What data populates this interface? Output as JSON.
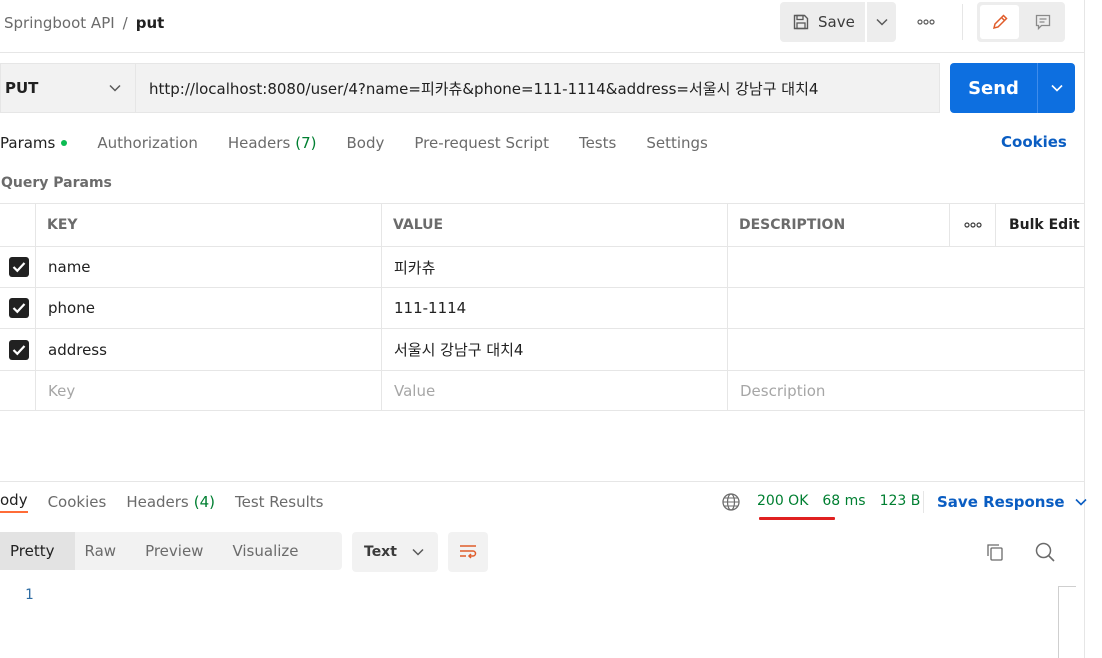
{
  "header": {
    "breadcrumb_parent": "Springboot API",
    "breadcrumb_sep": "/",
    "breadcrumb_current": "put",
    "save_label": "Save"
  },
  "request": {
    "method": "PUT",
    "url": "http://localhost:8080/user/4?name=피카츄&phone=111-1114&address=서울시 강남구 대치4",
    "send_label": "Send"
  },
  "tabs": [
    {
      "label": "Params",
      "count": ""
    },
    {
      "label": "Authorization",
      "count": ""
    },
    {
      "label": "Headers",
      "count": "(7)"
    },
    {
      "label": "Body",
      "count": ""
    },
    {
      "label": "Pre-request Script",
      "count": ""
    },
    {
      "label": "Tests",
      "count": ""
    },
    {
      "label": "Settings",
      "count": ""
    }
  ],
  "cookies_label": "Cookies",
  "query_params": {
    "title": "Query Params",
    "columns": {
      "key": "KEY",
      "value": "VALUE",
      "description": "DESCRIPTION",
      "bulk_edit": "Bulk Edit"
    },
    "rows": [
      {
        "key": "name",
        "value": "피카츄",
        "description": "",
        "checked": true
      },
      {
        "key": "phone",
        "value": "111-1114",
        "description": "",
        "checked": true
      },
      {
        "key": "address",
        "value": "서울시 강남구 대치4",
        "description": "",
        "checked": true
      }
    ],
    "placeholders": {
      "key": "Key",
      "value": "Value",
      "description": "Description"
    }
  },
  "response": {
    "tabs": [
      {
        "label": "ody",
        "count": ""
      },
      {
        "label": "Cookies",
        "count": ""
      },
      {
        "label": "Headers",
        "count": "(4)"
      },
      {
        "label": "Test Results",
        "count": ""
      }
    ],
    "status": "200 OK",
    "time": "68 ms",
    "size": "123 B",
    "save_response_label": "Save Response",
    "views": [
      "Pretty",
      "Raw",
      "Preview",
      "Visualize"
    ],
    "format": "Text",
    "line_number": "1"
  },
  "colors": {
    "send_blue": "#0d6fe0",
    "link_blue": "#0a5dc2",
    "status_green": "#007f31",
    "underline_red": "#e02020",
    "active_orange": "#ff6c37"
  }
}
